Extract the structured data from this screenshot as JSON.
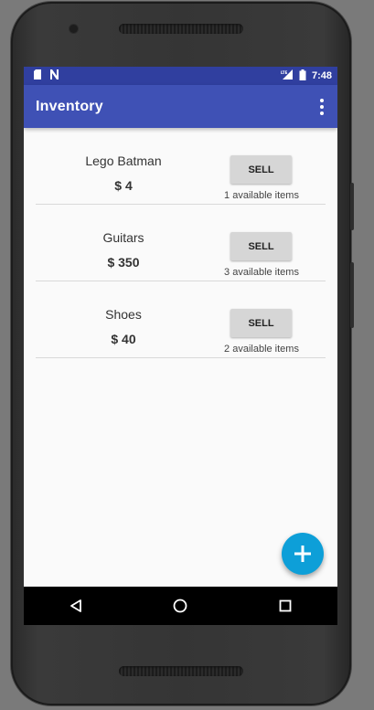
{
  "status_bar": {
    "left_icons": [
      "sd-card-icon",
      "n-notification-icon"
    ],
    "right_icons": [
      "lte-signal-icon",
      "battery-icon"
    ],
    "time": "7:48"
  },
  "toolbar": {
    "title": "Inventory",
    "menu_icon": "overflow-menu-icon"
  },
  "items": [
    {
      "name": "Lego Batman",
      "price": "$ 4",
      "button_label": "SELL",
      "availability": "1 available items"
    },
    {
      "name": "Guitars",
      "price": "$ 350",
      "button_label": "SELL",
      "availability": "3 available items"
    },
    {
      "name": "Shoes",
      "price": "$ 40",
      "button_label": "SELL",
      "availability": "2 available items"
    }
  ],
  "fab": {
    "icon": "plus-icon",
    "color": "#0d9fd8"
  },
  "navigation": {
    "buttons": [
      "back-icon",
      "home-icon",
      "recents-icon"
    ]
  },
  "colors": {
    "primary": "#3f51b5",
    "primary_dark": "#303f9f",
    "accent": "#0d9fd8"
  }
}
